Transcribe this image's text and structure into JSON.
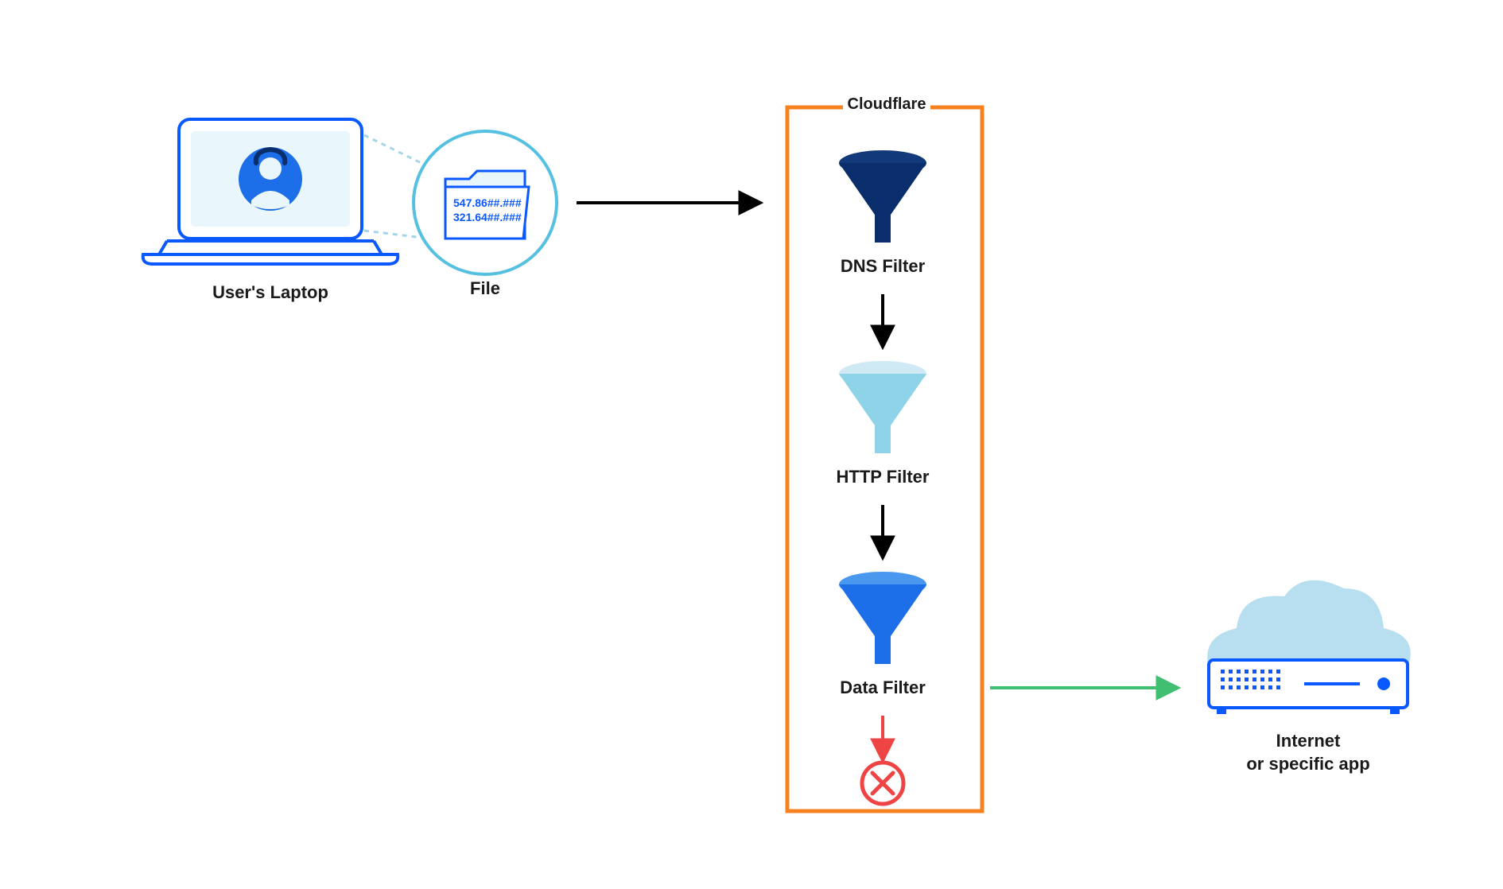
{
  "labels": {
    "laptop": "User's Laptop",
    "file": "File",
    "cloudflare": "Cloudflare",
    "dns_filter": "DNS Filter",
    "http_filter": "HTTP Filter",
    "data_filter": "Data Filter",
    "internet_line1": "Internet",
    "internet_line2": "or specific app"
  },
  "file_content": {
    "line1": "547.86##.###",
    "line2": "321.64##.###"
  },
  "icons": {
    "laptop": "laptop-icon",
    "avatar": "avatar-icon",
    "folder": "folder-icon",
    "funnel1": "funnel-dark-icon",
    "funnel2": "funnel-light-icon",
    "funnel3": "funnel-blue-icon",
    "reject": "x-circle-icon",
    "cloud": "cloud-icon",
    "server": "server-icon"
  },
  "colors": {
    "orange": "#f6821f",
    "navy": "#0a2e6b",
    "blue": "#1d6fe9",
    "light_blue": "#a7d5e8",
    "pale_blue": "#cfe9f5",
    "sky_blue": "#56c0e0",
    "red": "#ef4444",
    "green": "#3fbf6f",
    "black": "#000000",
    "lineblue": "#0a58ff"
  }
}
